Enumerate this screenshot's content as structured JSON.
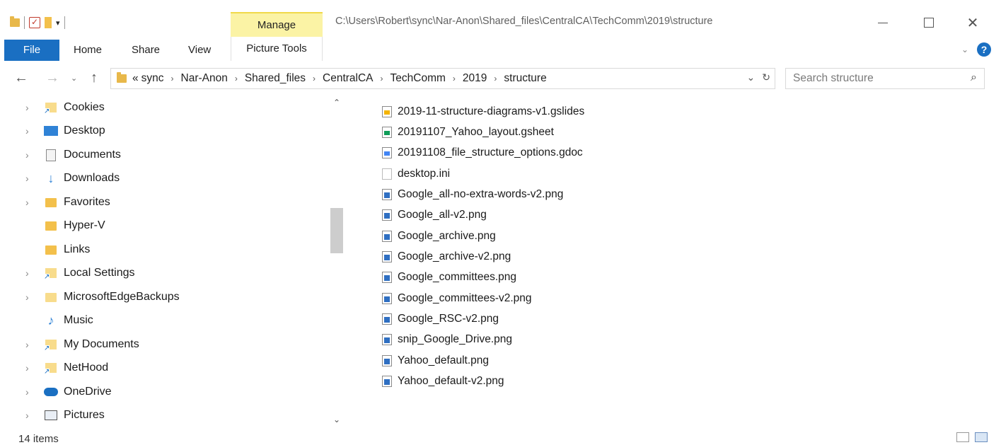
{
  "window": {
    "title_path": "C:\\Users\\Robert\\sync\\Nar-Anon\\Shared_files\\CentralCA\\TechComm\\2019\\structure",
    "manage_tab": "Manage",
    "controls": {
      "minimize": "—",
      "close": "✕"
    }
  },
  "ribbon": {
    "file": "File",
    "home": "Home",
    "share": "Share",
    "view": "View",
    "picture_tools": "Picture Tools"
  },
  "address": {
    "overflow": "«",
    "crumbs": [
      "sync",
      "Nar-Anon",
      "Shared_files",
      "CentralCA",
      "TechComm",
      "2019",
      "structure"
    ]
  },
  "search": {
    "placeholder": "Search structure"
  },
  "nav_pane": {
    "items": [
      {
        "label": "Cookies",
        "icon": "shortcut-folder-icon",
        "expandable": true
      },
      {
        "label": "Desktop",
        "icon": "desktop-icon",
        "expandable": true
      },
      {
        "label": "Documents",
        "icon": "documents-icon",
        "expandable": true
      },
      {
        "label": "Downloads",
        "icon": "download-arrow-icon",
        "expandable": true
      },
      {
        "label": "Favorites",
        "icon": "favorites-folder-icon",
        "expandable": true
      },
      {
        "label": "Hyper-V",
        "icon": "folder-icon",
        "expandable": false
      },
      {
        "label": "Links",
        "icon": "links-folder-icon",
        "expandable": false
      },
      {
        "label": "Local Settings",
        "icon": "shortcut-folder-icon",
        "expandable": true
      },
      {
        "label": "MicrosoftEdgeBackups",
        "icon": "folder-icon",
        "expandable": true
      },
      {
        "label": "Music",
        "icon": "music-note-icon",
        "expandable": false
      },
      {
        "label": "My Documents",
        "icon": "shortcut-folder-icon",
        "expandable": true
      },
      {
        "label": "NetHood",
        "icon": "shortcut-folder-icon",
        "expandable": true
      },
      {
        "label": "OneDrive",
        "icon": "onedrive-cloud-icon",
        "expandable": true
      },
      {
        "label": "Pictures",
        "icon": "pictures-icon",
        "expandable": true
      }
    ]
  },
  "files": [
    {
      "name": "2019-11-structure-diagrams-v1.gslides",
      "type": "slides"
    },
    {
      "name": "20191107_Yahoo_layout.gsheet",
      "type": "sheet"
    },
    {
      "name": "20191108_file_structure_options.gdoc",
      "type": "doc"
    },
    {
      "name": "desktop.ini",
      "type": "ini"
    },
    {
      "name": "Google_all-no-extra-words-v2.png",
      "type": "png"
    },
    {
      "name": "Google_all-v2.png",
      "type": "png"
    },
    {
      "name": "Google_archive.png",
      "type": "png"
    },
    {
      "name": "Google_archive-v2.png",
      "type": "png"
    },
    {
      "name": "Google_committees.png",
      "type": "png"
    },
    {
      "name": "Google_committees-v2.png",
      "type": "png"
    },
    {
      "name": "Google_RSC-v2.png",
      "type": "png"
    },
    {
      "name": "snip_Google_Drive.png",
      "type": "png"
    },
    {
      "name": "Yahoo_default.png",
      "type": "png"
    },
    {
      "name": "Yahoo_default-v2.png",
      "type": "png"
    }
  ],
  "status": {
    "items_count": "14 items"
  },
  "colors": {
    "accent": "#1a6fc2",
    "manage_highlight": "#fbf3a5"
  }
}
